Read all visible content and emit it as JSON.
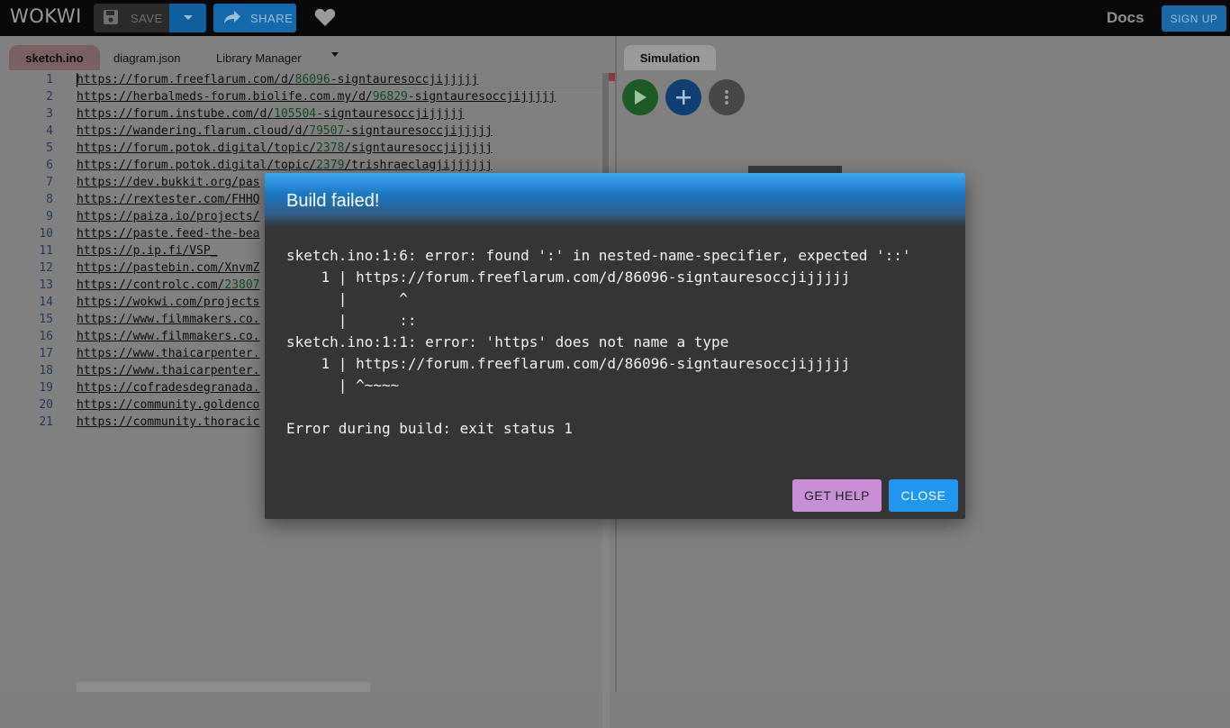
{
  "header": {
    "logo_text": "WOKWI",
    "save_label": "SAVE",
    "share_label": "SHARE",
    "docs_label": "Docs",
    "signup_label": "SIGN UP"
  },
  "editor": {
    "tabs": [
      {
        "label": "sketch.ino",
        "active": true
      },
      {
        "label": "diagram.json",
        "active": false
      },
      {
        "label": "Library Manager",
        "active": false
      }
    ],
    "lines": [
      {
        "n": "1",
        "a": "https://forum.freeflarum.com/d/",
        "b": "86096",
        "c": "-signtauresoccjijjjjj"
      },
      {
        "n": "2",
        "a": "https://herbalmeds-forum.biolife.com.my/d/",
        "b": "96829",
        "c": "-signtauresoccjijjjjj"
      },
      {
        "n": "3",
        "a": "https://forum.instube.com/d/",
        "b": "105504",
        "c": "-signtauresoccjijjjjj"
      },
      {
        "n": "4",
        "a": "https://wandering.flarum.cloud/d/",
        "b": "79507",
        "c": "-signtauresoccjijjjjj"
      },
      {
        "n": "5",
        "a": "https://forum.potok.digital/topic/",
        "b": "2378",
        "c": "/signtauresoccjijjjjj"
      },
      {
        "n": "6",
        "a": "https://forum.potok.digital/topic/",
        "b": "2379",
        "c": "/trishraeclagjijjjjjj"
      },
      {
        "n": "7",
        "a": "https://dev.bukkit.org/pas",
        "b": "",
        "c": ""
      },
      {
        "n": "8",
        "a": "https://rextester.com/FHHQ",
        "b": "",
        "c": ""
      },
      {
        "n": "9",
        "a": "https://paiza.io/projects/",
        "b": "",
        "c": ""
      },
      {
        "n": "10",
        "a": "https://paste.feed-the-bea",
        "b": "",
        "c": ""
      },
      {
        "n": "11",
        "a": "https://p.ip.fi/VSP_",
        "b": "",
        "c": ""
      },
      {
        "n": "12",
        "a": "https://pastebin.com/XnvmZ",
        "b": "",
        "c": ""
      },
      {
        "n": "13",
        "a": "https://controlc.com/",
        "b": "23807",
        "c": ""
      },
      {
        "n": "14",
        "a": "https://wokwi.com/projects",
        "b": "",
        "c": ""
      },
      {
        "n": "15",
        "a": "https://www.filmmakers.co.",
        "b": "",
        "c": ""
      },
      {
        "n": "16",
        "a": "https://www.filmmakers.co.",
        "b": "",
        "c": ""
      },
      {
        "n": "17",
        "a": "https://www.thaicarpenter.",
        "b": "",
        "c": ""
      },
      {
        "n": "18",
        "a": "https://www.thaicarpenter.",
        "b": "",
        "c": ""
      },
      {
        "n": "19",
        "a": "https://cofradesdegranada.",
        "b": "",
        "c": ""
      },
      {
        "n": "20",
        "a": "https://community.goldenco",
        "b": "",
        "c": ""
      },
      {
        "n": "21",
        "a": "https://community.thoracic",
        "b": "",
        "c": ""
      }
    ]
  },
  "simulation": {
    "tab_label": "Simulation"
  },
  "dialog": {
    "title": "Build failed!",
    "message": "sketch.ino:1:6: error: found ':' in nested-name-specifier, expected '::'\n    1 | https://forum.freeflarum.com/d/86096-signtauresoccjijjjjj\n      |      ^\n      |      ::\nsketch.ino:1:1: error: 'https' does not name a type\n    1 | https://forum.freeflarum.com/d/86096-signtauresoccjijjjjj\n      | ^~~~~\n\nError during build: exit status 1",
    "help_label": "GET HELP",
    "close_label": "CLOSE"
  },
  "colors": {
    "accent_blue": "#2196f3",
    "help_purple": "#c98fd6",
    "play_green": "#1c5c24"
  }
}
